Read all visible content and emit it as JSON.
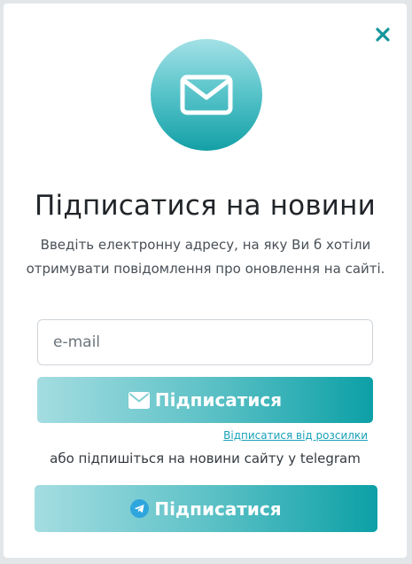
{
  "modal": {
    "title": "Підписатися на новини",
    "description": "Введіть електронну адресу, на яку Ви б хотіли отримувати повідомлення про оновлення на сайті.",
    "email_placeholder": "e-mail",
    "email_value": "",
    "subscribe_label": "Підписатися",
    "unsubscribe_link": "Відписатися від розсилки",
    "telegram_note": "або підпишіться на новини сайту у telegram",
    "telegram_button_label": "Підписатися"
  },
  "icons": {
    "close": "close-icon",
    "header": "envelope-icon",
    "subscribe": "envelope-icon",
    "telegram": "telegram-icon"
  },
  "colors": {
    "accent": "#13a0a6",
    "accent_light": "#a4dde1",
    "close": "#14959b",
    "link": "#17a2b8",
    "telegram": "#2ea6dd"
  }
}
